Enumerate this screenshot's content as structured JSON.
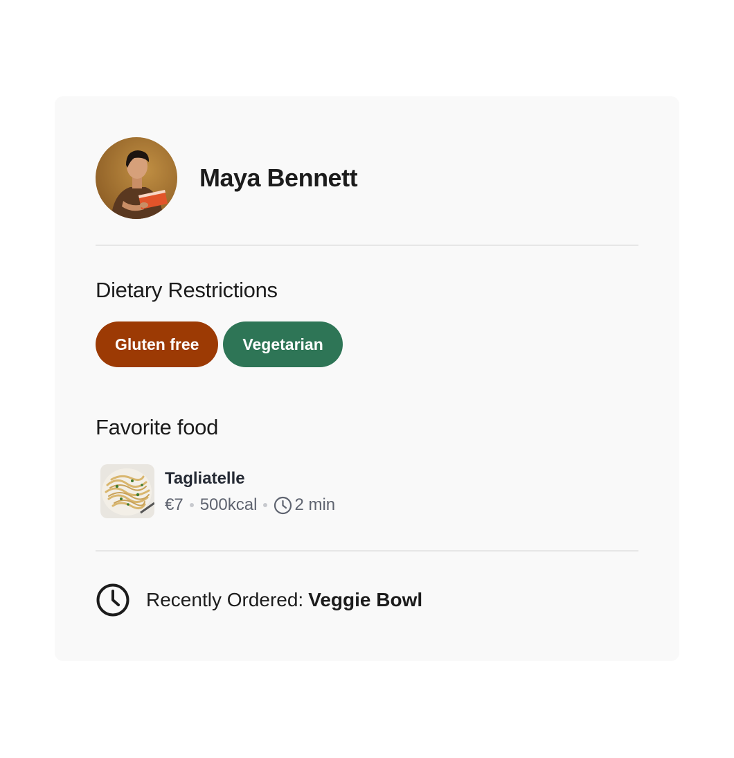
{
  "profile": {
    "name": "Maya Bennett"
  },
  "dietary": {
    "title": "Dietary Restrictions",
    "tags": [
      {
        "label": "Gluten free",
        "color": "#9c3a04"
      },
      {
        "label": "Vegetarian",
        "color": "#2e7556"
      }
    ]
  },
  "favorite": {
    "title": "Favorite food",
    "item": {
      "name": "Tagliatelle",
      "price": "€7",
      "calories": "500kcal",
      "time": "2 min",
      "time_icon": "clock-icon"
    }
  },
  "recent": {
    "label": "Recently Ordered:",
    "value": "Veggie Bowl",
    "icon": "clock-icon"
  }
}
